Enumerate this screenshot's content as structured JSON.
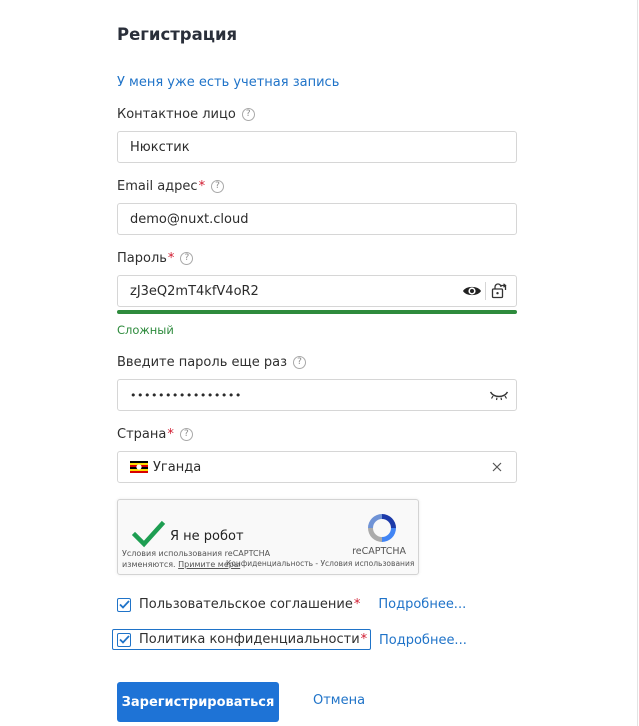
{
  "form": {
    "title": "Регистрация",
    "login_link": "У меня уже есть учетная запись"
  },
  "fields": {
    "contact": {
      "label": "Контактное лицо",
      "value": "Нюкстик"
    },
    "email": {
      "label": "Email адрес",
      "required_mark": "*",
      "value": "demo@nuxt.cloud"
    },
    "password": {
      "label": "Пароль",
      "required_mark": "*",
      "value": "zJ3eQ2mT4kfV4oR2",
      "strength_text": "Сложный",
      "strength": 1.0
    },
    "password_repeat": {
      "label": "Введите пароль еще раз",
      "value": "••••••••••••••••"
    },
    "country": {
      "label": "Страна",
      "required_mark": "*",
      "value": "Уганда"
    }
  },
  "help_glyph": "?",
  "captcha": {
    "checked": true,
    "label": "Я не робот",
    "brand": "reCAPTCHA",
    "terms_line1": "Условия использования reCAPTCHA",
    "terms_line2_prefix": "изменяются.",
    "terms_line2_link": "Примите меры",
    "privacy": "Конфиденциальность - Условия использования"
  },
  "agreements": {
    "terms": {
      "label": "Пользовательское соглашение",
      "required_mark": "*",
      "more": "Подробнее...",
      "checked": true
    },
    "privacy": {
      "label": "Политика конфиденциальности",
      "required_mark": "*",
      "more": "Подробнее...",
      "checked": true
    }
  },
  "actions": {
    "submit": "Зарегистрироваться",
    "cancel": "Отмена"
  },
  "colors": {
    "accent": "#1e73d6",
    "link": "#1f73c8",
    "required": "#d0192e",
    "strength_strong": "#2e8b3d"
  }
}
